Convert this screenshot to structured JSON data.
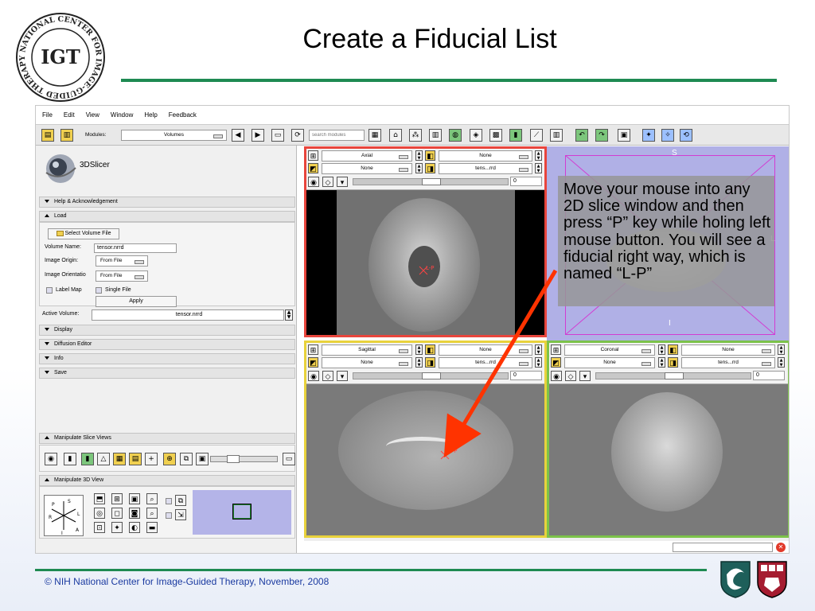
{
  "slide": {
    "title": "Create a Fiducial List",
    "logo_text": "NATIONAL CENTER FOR IMAGE-GUIDED THERAPY",
    "logo_letters": "IGT",
    "callout": "Move your mouse into any 2D slice window and then press “P” key while holing left mouse button. You will see a fiducial right way, which is named “L-P”",
    "footer": "© NIH National Center for Image-Guided Therapy, November, 2008",
    "accent_color": "#1e8a52",
    "arrow_color": "#ff3300"
  },
  "app": {
    "menu": [
      "File",
      "Edit",
      "View",
      "Window",
      "Help",
      "Feedback"
    ],
    "toolbar": {
      "modules_label": "Modules:",
      "module_selected": "Volumes",
      "search_placeholder": "search modules"
    },
    "brand": "3DSlicer",
    "sections": {
      "help": "Help & Acknowledgement",
      "load": "Load",
      "display": "Display",
      "diffusion": "Diffusion Editor",
      "info": "Info",
      "save": "Save",
      "slice_views": "Manipulate Slice Views",
      "view3d": "Manipulate 3D View"
    },
    "load": {
      "select_button": "Select Volume File",
      "volume_name_label": "Volume Name:",
      "volume_name_value": "tensor.nrrd",
      "origin_label": "Image Origin:",
      "origin_value": "From File",
      "orientation_label": "Image Orientatio",
      "orientation_value": "From File",
      "label_map": "Label Map",
      "single_file": "Single File",
      "apply": "Apply"
    },
    "active_volume_label": "Active Volume:",
    "active_volume_value": "tensor.nrrd",
    "orient_labels": {
      "p": "P",
      "s": "S",
      "r": "R",
      "l": "L",
      "i": "I",
      "a": "A"
    },
    "viewers": {
      "red": {
        "orientation": "Axial",
        "fg": "None",
        "bg": "tens...rrd",
        "label": "None",
        "lb": "None",
        "offset": "0",
        "fiducial": "L-P",
        "color": "#e8453c"
      },
      "yellow": {
        "orientation": "Sagittal",
        "fg": "None",
        "bg": "tens...rrd",
        "label": "None",
        "lb": "None",
        "offset": "0",
        "fiducial": "L-P",
        "color": "#e8d23c"
      },
      "green": {
        "orientation": "Coronal",
        "fg": "None",
        "bg": "tens...rrd",
        "label": "None",
        "lb": "None",
        "offset": "0",
        "color": "#7cc24a"
      },
      "three_d": {
        "superior": "S",
        "left": "L",
        "inferior": "I",
        "bg_color": "#b0b0e6"
      }
    }
  }
}
